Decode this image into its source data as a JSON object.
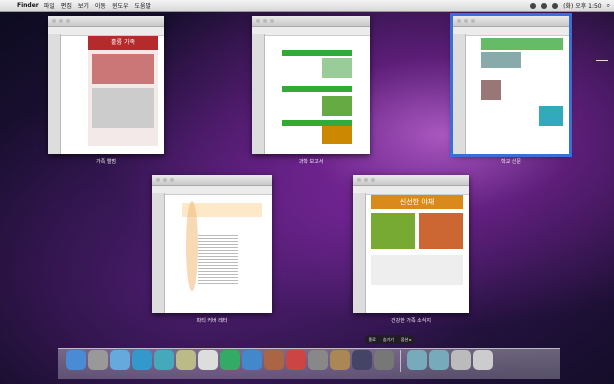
{
  "menubar": {
    "apple": "",
    "app": "Finder",
    "items": [
      "파일",
      "편집",
      "보기",
      "이동",
      "윈도우",
      "도움말"
    ],
    "clock": "(화) 오후 1:50"
  },
  "windows": [
    {
      "label": "가족 앨범",
      "title": "훌륭 가족"
    },
    {
      "label": "과학 보고서",
      "title": ""
    },
    {
      "label": "학교 신문",
      "title": ""
    },
    {
      "label": "파티 커버 레터",
      "title": ""
    },
    {
      "label": "건강한 가족 소식지",
      "title": "신선한 야채"
    }
  ],
  "bottom_buttons": [
    "종료",
    "숨기기",
    "옵션 ▸"
  ],
  "colors": {
    "selection": "#3b6fd8",
    "menu_bg": "#e6e6e6"
  }
}
